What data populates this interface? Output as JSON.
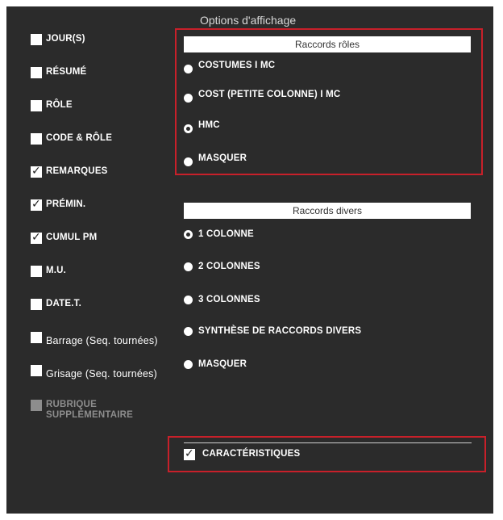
{
  "title": "Options d'affichage",
  "left_options": [
    {
      "label": "JOUR(S)",
      "checked": false
    },
    {
      "label": "RÉSUMÉ",
      "checked": false
    },
    {
      "label": "RÔLE",
      "checked": false
    },
    {
      "label": "CODE & RÔLE",
      "checked": false
    },
    {
      "label": "REMARQUES",
      "checked": true
    },
    {
      "label": "PRÉMIN.",
      "checked": true
    },
    {
      "label": "CUMUL PM",
      "checked": true
    },
    {
      "label": "M.U.",
      "checked": false
    },
    {
      "label": "DATE.T.",
      "checked": false
    },
    {
      "label": "Barrage (Seq. tournées)",
      "checked": false
    },
    {
      "label": "Grisage (Seq. tournées)",
      "checked": false
    },
    {
      "label_line1": "RUBRIQUE",
      "label_line2": "SUPPLÉMENTAIRE",
      "checked": false,
      "disabled": true
    }
  ],
  "raccords_roles": {
    "header": "Raccords rôles",
    "options": [
      "COSTUMES I MC",
      "COST (PETITE COLONNE) I MC",
      "HMC",
      "MASQUER"
    ],
    "selected": "HMC"
  },
  "raccords_divers": {
    "header": "Raccords divers",
    "options": [
      "1 COLONNE",
      "2 COLONNES",
      "3 COLONNES",
      "SYNTHÈSE DE RACCORDS DIVERS",
      "MASQUER"
    ],
    "selected": "1 COLONNE"
  },
  "caracteristiques": {
    "label": "CARACTÉRISTIQUES",
    "checked": true
  },
  "colors": {
    "panel_bg": "#2b2b2b",
    "highlight_border": "#c8202a",
    "disabled_text": "#8d8d8d"
  }
}
